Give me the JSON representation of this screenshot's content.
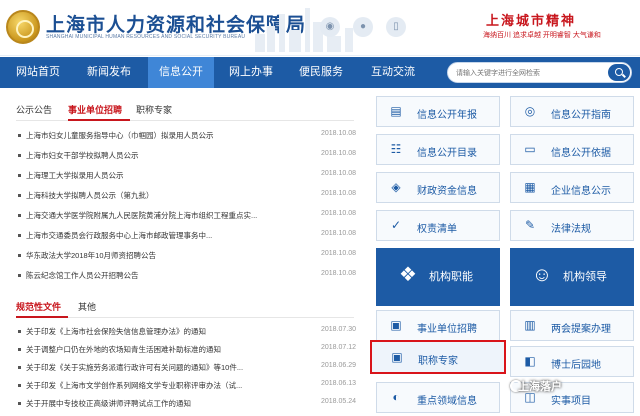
{
  "header": {
    "title": "上海市人力资源和社会保障局",
    "subtitle": "SHANGHAI MUNICIPAL HUMAN RESOURCES AND SOCIAL SECURITY BUREAU",
    "spirit_title": "上海城市精神",
    "spirit_words": "海纳百川  追求卓越  开明睿智  大气谦和"
  },
  "nav": {
    "items": [
      "网站首页",
      "新闻发布",
      "信息公开",
      "网上办事",
      "便民服务",
      "互动交流"
    ],
    "active_index": 2
  },
  "search": {
    "placeholder": "请输入关键字进行全网检索"
  },
  "notices": {
    "tabs": [
      "公示公告",
      "事业单位招聘",
      "职称专家"
    ],
    "active_tab": 1,
    "items": [
      {
        "title": "上海市妇女儿童服务指导中心（巾帼园）拟录用人员公示",
        "date": "2018.10.08"
      },
      {
        "title": "上海市妇女干部学校拟聘人员公示",
        "date": "2018.10.08"
      },
      {
        "title": "上海理工大学拟录用人员公示",
        "date": "2018.10.08"
      },
      {
        "title": "上海科技大学拟聘人员公示（第九批）",
        "date": "2018.10.08"
      },
      {
        "title": "上海交通大学医学院附属九人民医院黄浦分院上海市组织工程重点实...",
        "date": "2018.10.08"
      },
      {
        "title": "上海市交通委员会行政服务中心上海市邮政管理事务中...",
        "date": "2018.10.08"
      },
      {
        "title": "华东政法大学2018年10月师资招聘公告",
        "date": "2018.10.08"
      },
      {
        "title": "陈云纪念馆工作人员公开招聘公告",
        "date": "2018.10.08"
      }
    ]
  },
  "regulations": {
    "tabs": [
      "规范性文件",
      "其他"
    ],
    "active_tab": 0,
    "items": [
      {
        "title": "关于印发《上海市社会保险失信信息管理办法》的通知",
        "date": "2018.07.30"
      },
      {
        "title": "关于调整户口仍在外地的农场知青生活困难补助标准的通知",
        "date": "2018.07.12"
      },
      {
        "title": "关于印发《关于实施劳务派遣行政许可有关问题的通知》等10件...",
        "date": "2018.06.29"
      },
      {
        "title": "关于印发《上海市文学创作系列网络文学专业职称评审办法（试...",
        "date": "2018.06.13"
      },
      {
        "title": "关于开展中专技校正高级讲师评聘试点工作的通知",
        "date": "2018.05.24"
      }
    ]
  },
  "quick_links": {
    "small": [
      {
        "label": "信息公开年报",
        "icon": "report-icon"
      },
      {
        "label": "信息公开指南",
        "icon": "compass-icon"
      },
      {
        "label": "信息公开目录",
        "icon": "catalog-icon"
      },
      {
        "label": "信息公开依据",
        "icon": "document-icon"
      },
      {
        "label": "财政资金信息",
        "icon": "finance-icon"
      },
      {
        "label": "企业信息公示",
        "icon": "enterprise-icon"
      },
      {
        "label": "权责清单",
        "icon": "checklist-icon"
      },
      {
        "label": "法律法规",
        "icon": "law-icon"
      }
    ],
    "big": [
      {
        "label": "机构职能",
        "icon": "org-icon"
      },
      {
        "label": "机构领导",
        "icon": "leaders-icon"
      }
    ],
    "small2": [
      {
        "label": "事业单位招聘",
        "icon": "recruit-icon"
      },
      {
        "label": "两会提案办理",
        "icon": "proposal-icon"
      },
      {
        "label": "职称专家",
        "icon": "expert-icon"
      },
      {
        "label": "博士后园地",
        "icon": "postdoc-icon"
      },
      {
        "label": "重点领域信息",
        "icon": "focus-icon"
      },
      {
        "label": "实事项目",
        "icon": "project-icon"
      }
    ]
  },
  "watermark": {
    "text": "上海落户"
  }
}
